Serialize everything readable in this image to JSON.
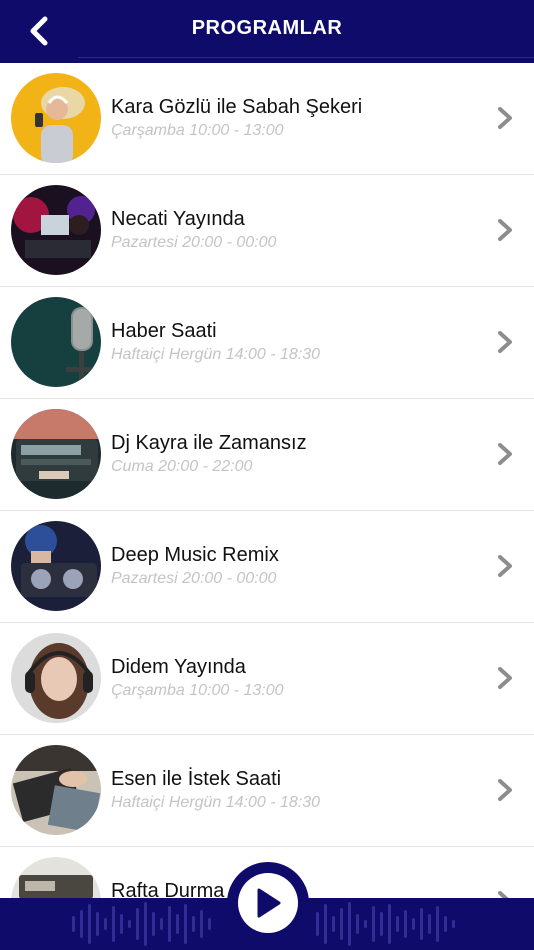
{
  "header": {
    "title": "PROGRAMLAR",
    "back_icon": "chevron-left-icon"
  },
  "programs": [
    {
      "name": "Kara Gözlü ile Sabah Şekeri",
      "schedule": "Çarşamba 10:00 - 13:00"
    },
    {
      "name": "Necati Yayında",
      "schedule": "Pazartesi 20:00 - 00:00"
    },
    {
      "name": "Haber Saati",
      "schedule": "Haftaiçi Hergün 14:00 - 18:30"
    },
    {
      "name": "Dj Kayra ile Zamansız",
      "schedule": "Cuma 20:00 - 22:00"
    },
    {
      "name": "Deep Music Remix",
      "schedule": "Pazartesi 20:00 - 00:00"
    },
    {
      "name": "Didem Yayında",
      "schedule": "Çarşamba 10:00 - 13:00"
    },
    {
      "name": "Esen ile İstek Saati",
      "schedule": "Haftaiçi Hergün 14:00 - 18:30"
    },
    {
      "name": "Rafta Durma",
      "schedule": ""
    }
  ],
  "player": {
    "play_icon": "play-icon"
  },
  "colors": {
    "primary": "#0f0b6a",
    "schedule_text": "#c4c4c4",
    "chevron": "#8e8e8e"
  }
}
